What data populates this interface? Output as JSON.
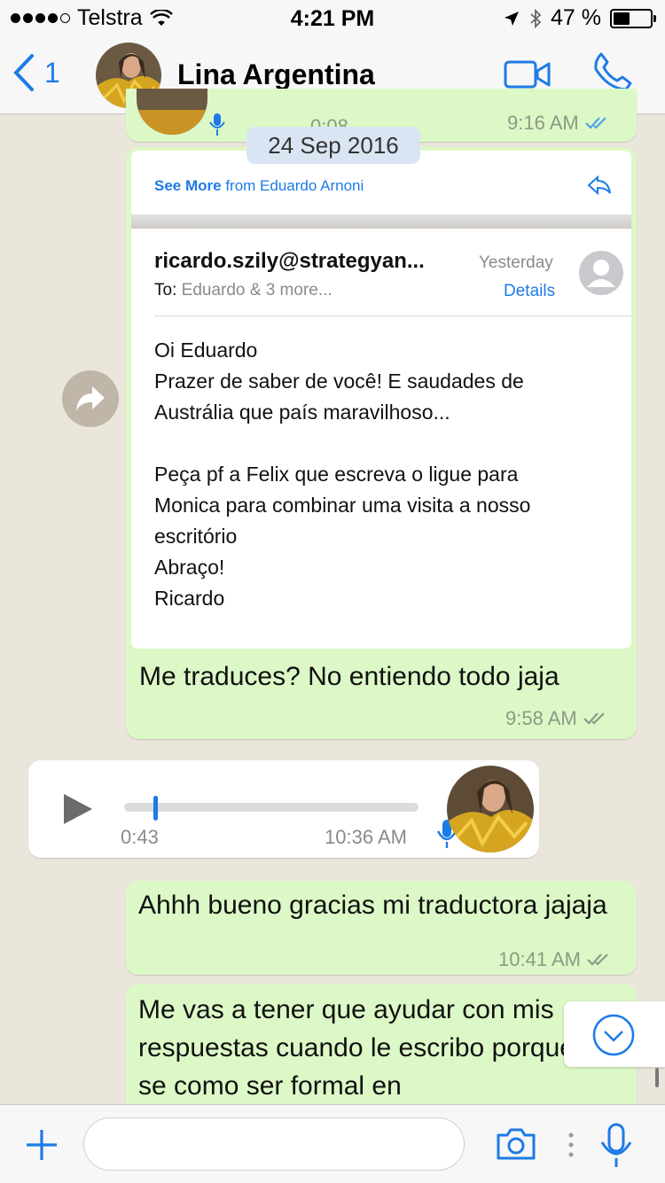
{
  "status": {
    "carrier": "Telstra",
    "time": "4:21 PM",
    "battery_percent": "47 %",
    "battery_level": 0.47
  },
  "header": {
    "back_count": "1",
    "contact_name": "Lina Argentina"
  },
  "chat": {
    "prev_voice_duration": "0:08",
    "prev_voice_time": "9:16 AM",
    "date_separator": "24 Sep 2016",
    "email": {
      "see_more": "See More",
      "from_label": "from Eduardo Arnoni",
      "sender": "ricardo.szily@strategyan...",
      "to_label": "To:",
      "to_value": "Eduardo & 3 more...",
      "date": "Yesterday",
      "details": "Details",
      "body": "Oi Eduardo\nPrazer de saber de você! E saudades de\nAustrália que país maravilhoso...\n\nPeça pf a Felix que escreva o ligue para\nMonica para combinar uma visita a nosso\nescritório\nAbraço!\nRicardo"
    },
    "caption": "Me traduces? No entiendo todo jaja",
    "caption_time": "9:58 AM",
    "voice": {
      "duration": "0:43",
      "time": "10:36 AM",
      "progress": 0.1
    },
    "msg2": "Ahhh bueno gracias mi traductora jajaja",
    "msg2_time": "10:41 AM",
    "msg3": "Me vas a tener que ayudar con mis respuestas cuando le escribo porque no se como ser formal en"
  },
  "colors": {
    "accent": "#1e7be6",
    "outgoing_bubble": "#dcf8c6",
    "incoming_bubble": "#ffffff",
    "chat_background": "#ebe6dc"
  }
}
